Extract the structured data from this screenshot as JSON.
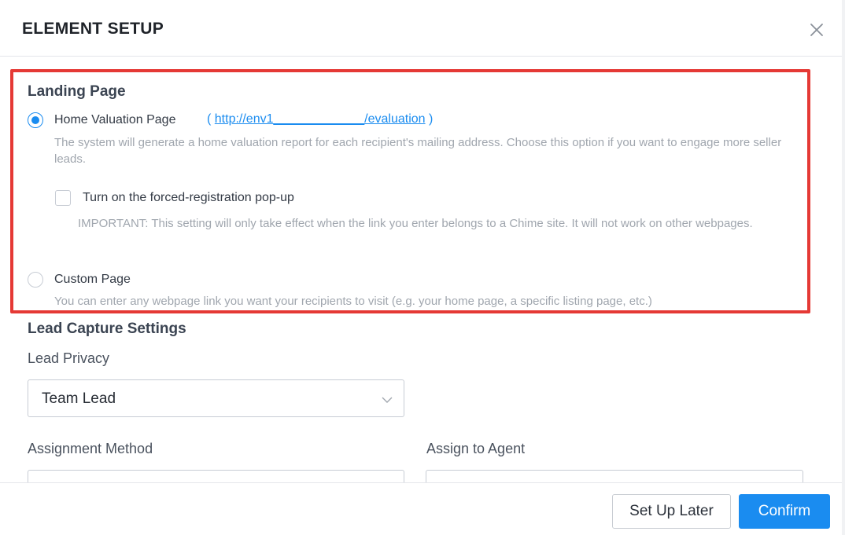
{
  "dialog": {
    "title": "ELEMENT SETUP"
  },
  "landing": {
    "title": "Landing Page",
    "home_option": {
      "label": "Home Valuation Page",
      "link_open": "(",
      "link_text": "http://env1_____________/evaluation",
      "link_close": ")",
      "description": "The system will generate a home valuation report for each recipient's mailing address. Choose this option if you want to engage more seller leads.",
      "selected": true
    },
    "forced_registration": {
      "label": "Turn on the forced-registration pop-up",
      "checked": false,
      "note": "IMPORTANT: This setting will only take effect when the link you enter belongs to a Chime site. It will not work on other webpages."
    },
    "custom_option": {
      "label": "Custom Page",
      "description": "You can enter any webpage link you want your recipients to visit (e.g. your home page, a specific listing page, etc.)",
      "selected": false
    }
  },
  "lead_capture": {
    "title": "Lead Capture Settings",
    "privacy_label": "Lead Privacy",
    "privacy_value": "Team Lead",
    "assignment_label": "Assignment Method",
    "agent_label": "Assign to Agent"
  },
  "footer": {
    "later_label": "Set Up Later",
    "confirm_label": "Confirm"
  },
  "colors": {
    "accent": "#1a8cf0",
    "highlight": "#e53935"
  }
}
